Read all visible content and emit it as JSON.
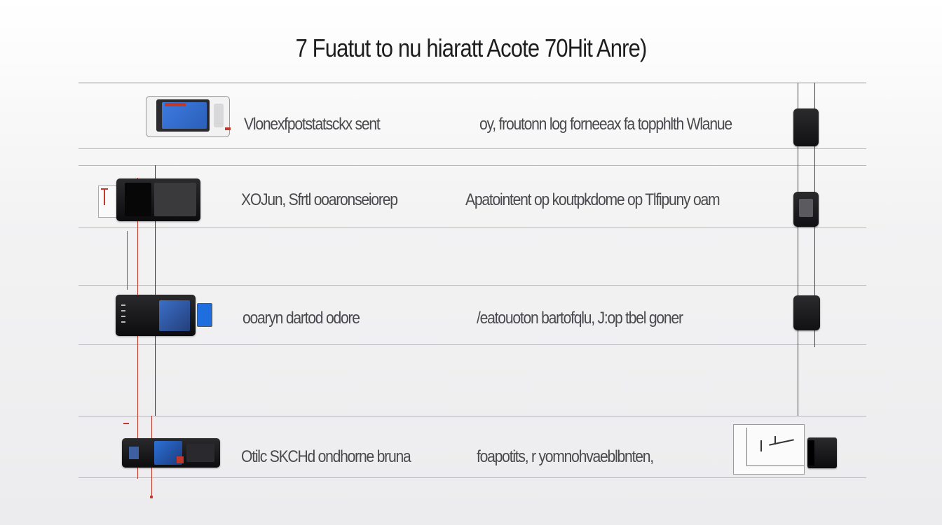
{
  "title": "7 Fuatut to nu    hiaratt Acote 70Hit Anre)",
  "rows": [
    {
      "col1": "Vlonexfpotstatsckx sent",
      "col2": "oy, froutonn log forneeax  fa topphlth Wlanue"
    },
    {
      "col1": "XOJun, Sfrtl ooaronseiorep",
      "col2": "Apatointent op koutpkdome op  Tlfipuny oam"
    },
    {
      "col1": "ooaryn dartod odore",
      "col2": "/eatouoton  bartofqlu, J:op  tbel goner"
    },
    {
      "col1": "Otilc SKCHd ondhorne  bruna",
      "col2": "foapotits, r yomnohvaeblbnten,"
    }
  ],
  "icons": [
    "device-icon",
    "phone-icon",
    "tablet-icon",
    "watch-icon"
  ],
  "colors": {
    "accent_red": "#c0392b",
    "screen_blue": "#2c5fb8",
    "device_black": "#111113"
  }
}
